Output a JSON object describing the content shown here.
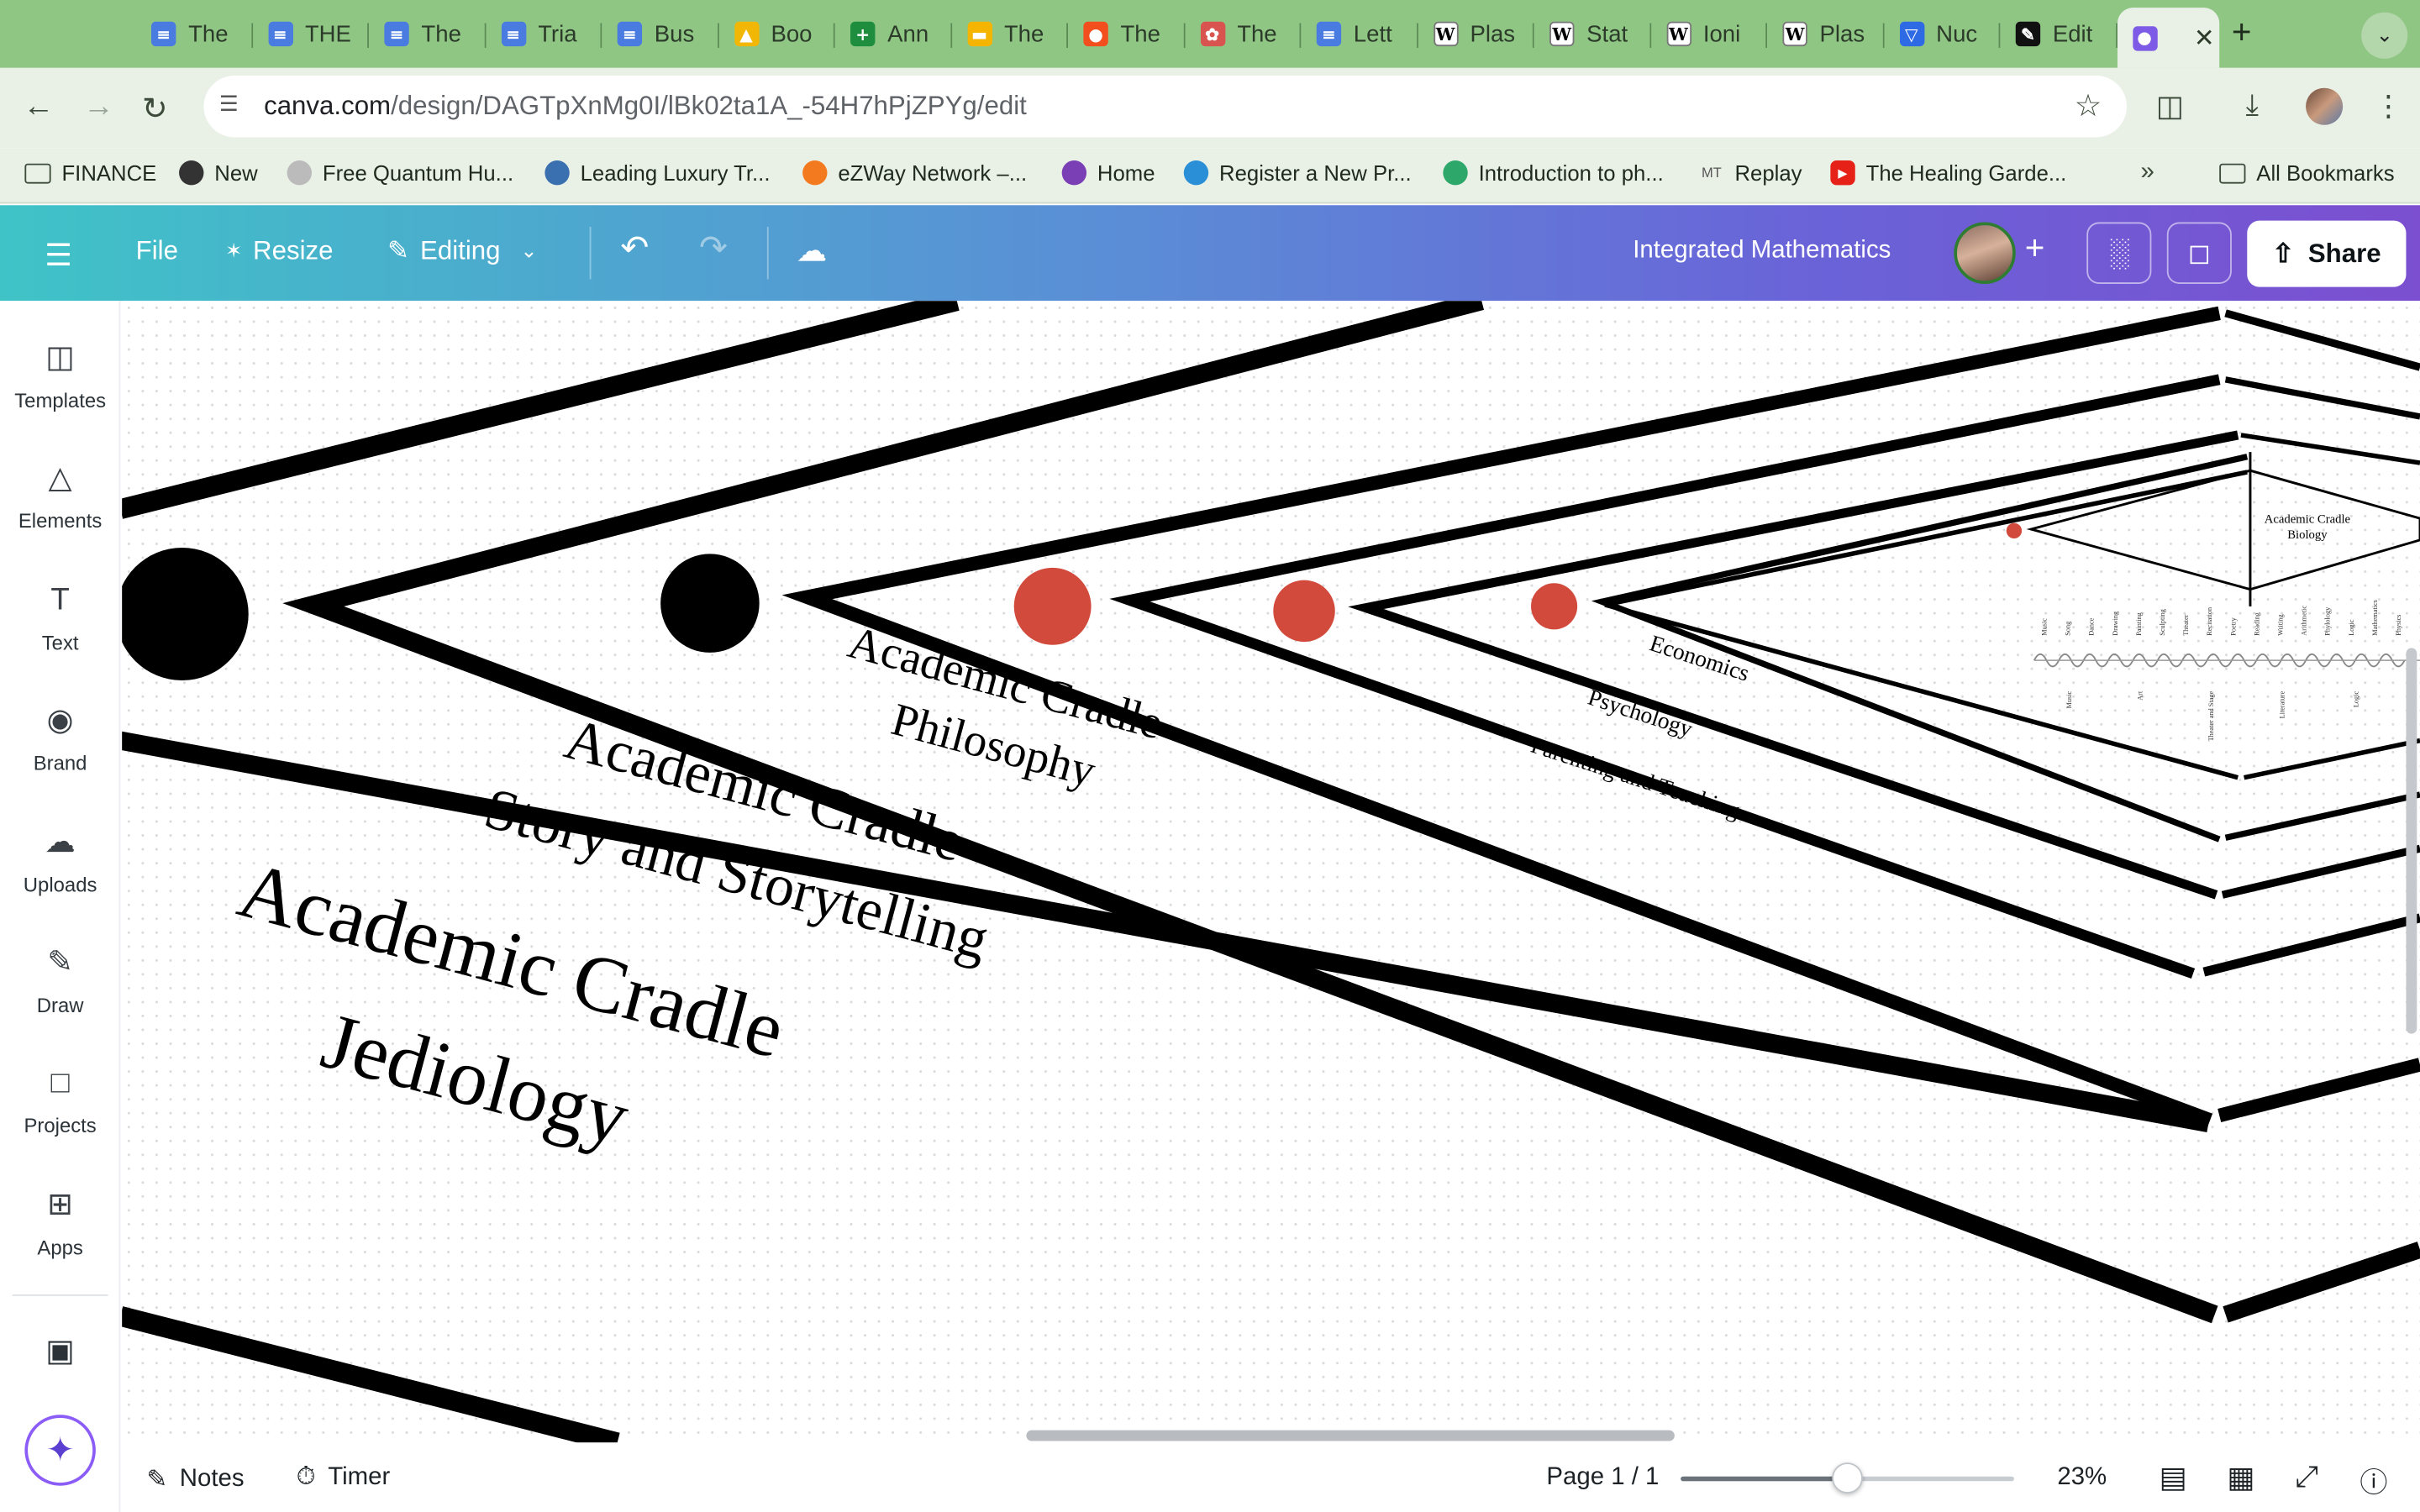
{
  "browser": {
    "tabs": [
      {
        "label": "The",
        "icon": "docs-icon"
      },
      {
        "label": "THE",
        "icon": "docs-icon"
      },
      {
        "label": "The",
        "icon": "docs-icon"
      },
      {
        "label": "Tria",
        "icon": "docs-icon"
      },
      {
        "label": "Bus",
        "icon": "docs-icon"
      },
      {
        "label": "Boo",
        "icon": "drive-icon"
      },
      {
        "label": "Ann",
        "icon": "sheets-icon"
      },
      {
        "label": "The",
        "icon": "slides-icon"
      },
      {
        "label": "The",
        "icon": "figma-icon"
      },
      {
        "label": "The",
        "icon": "flower-icon"
      },
      {
        "label": "Lett",
        "icon": "docs-icon"
      },
      {
        "label": "Plas",
        "icon": "wikipedia-icon"
      },
      {
        "label": "Stat",
        "icon": "wikipedia-icon"
      },
      {
        "label": "Ioni",
        "icon": "wikipedia-icon"
      },
      {
        "label": "Plas",
        "icon": "wikipedia-icon"
      },
      {
        "label": "Nuc",
        "icon": "cup-icon"
      },
      {
        "label": "Edit",
        "icon": "edit-icon"
      },
      {
        "label": "",
        "icon": "canva-icon"
      }
    ],
    "url_host": "canva.com",
    "url_path": "/design/DAGTpXnMg0I/lBk02ta1A_-54H7hPjZPYg/edit",
    "bookmarks": [
      {
        "label": "FINANCE",
        "icon": "folder-icon"
      },
      {
        "label": "New",
        "icon": "globe-icon"
      },
      {
        "label": "Free Quantum Hu...",
        "icon": "qhd-icon"
      },
      {
        "label": "Leading Luxury Tr...",
        "icon": "earth-icon"
      },
      {
        "label": "eZWay Network –...",
        "icon": "ezway-icon"
      },
      {
        "label": "Home",
        "icon": "heart-icon"
      },
      {
        "label": "Register a New Pr...",
        "icon": "register-icon"
      },
      {
        "label": "Introduction to ph...",
        "icon": "shield-icon"
      },
      {
        "label": "Replay",
        "icon": "mt-icon"
      },
      {
        "label": "The Healing Garde...",
        "icon": "youtube-icon"
      }
    ],
    "all_bookmarks": "All Bookmarks"
  },
  "editor": {
    "file": "File",
    "resize": "Resize",
    "mode": "Editing",
    "doc_title": "Integrated Mathematics",
    "share": "Share"
  },
  "sidebar": {
    "items": [
      {
        "label": "Templates",
        "icon": "templates-icon"
      },
      {
        "label": "Elements",
        "icon": "elements-icon"
      },
      {
        "label": "Text",
        "icon": "text-icon"
      },
      {
        "label": "Brand",
        "icon": "brand-icon"
      },
      {
        "label": "Uploads",
        "icon": "uploads-icon"
      },
      {
        "label": "Draw",
        "icon": "draw-icon"
      },
      {
        "label": "Projects",
        "icon": "projects-icon"
      },
      {
        "label": "Apps",
        "icon": "apps-icon"
      }
    ]
  },
  "design": {
    "labels": {
      "jediology": [
        "Academic Cradle",
        "Jediology"
      ],
      "story": [
        "Academic Cradle",
        "Story and Storytelling"
      ],
      "philosophy": [
        "Academic Cradle",
        "Philosophy"
      ],
      "economics": "Economics",
      "psychology": "Psychology",
      "parenting": "Parenting and Teaching",
      "biology": [
        "Academic Cradle",
        "Biology"
      ]
    },
    "tiny_top_labels": [
      "Music",
      "Song",
      "Dance",
      "Drawing",
      "Painting",
      "Sculpting",
      "Theater",
      "Recitation",
      "Poetry",
      "Reading",
      "Writing",
      "Arithmetic",
      "Phylology",
      "Logic",
      "Mathematics",
      "Physics"
    ],
    "tiny_bottom_labels": [
      "Music",
      "Art",
      "Theater and Stage",
      "Literature",
      "Logic"
    ],
    "colors": {
      "red_dot": "#d14a3c",
      "black": "#000000"
    }
  },
  "footer": {
    "notes": "Notes",
    "timer": "Timer",
    "page": "Page 1 / 1",
    "zoom": "23%",
    "zoom_fraction": 0.5
  }
}
